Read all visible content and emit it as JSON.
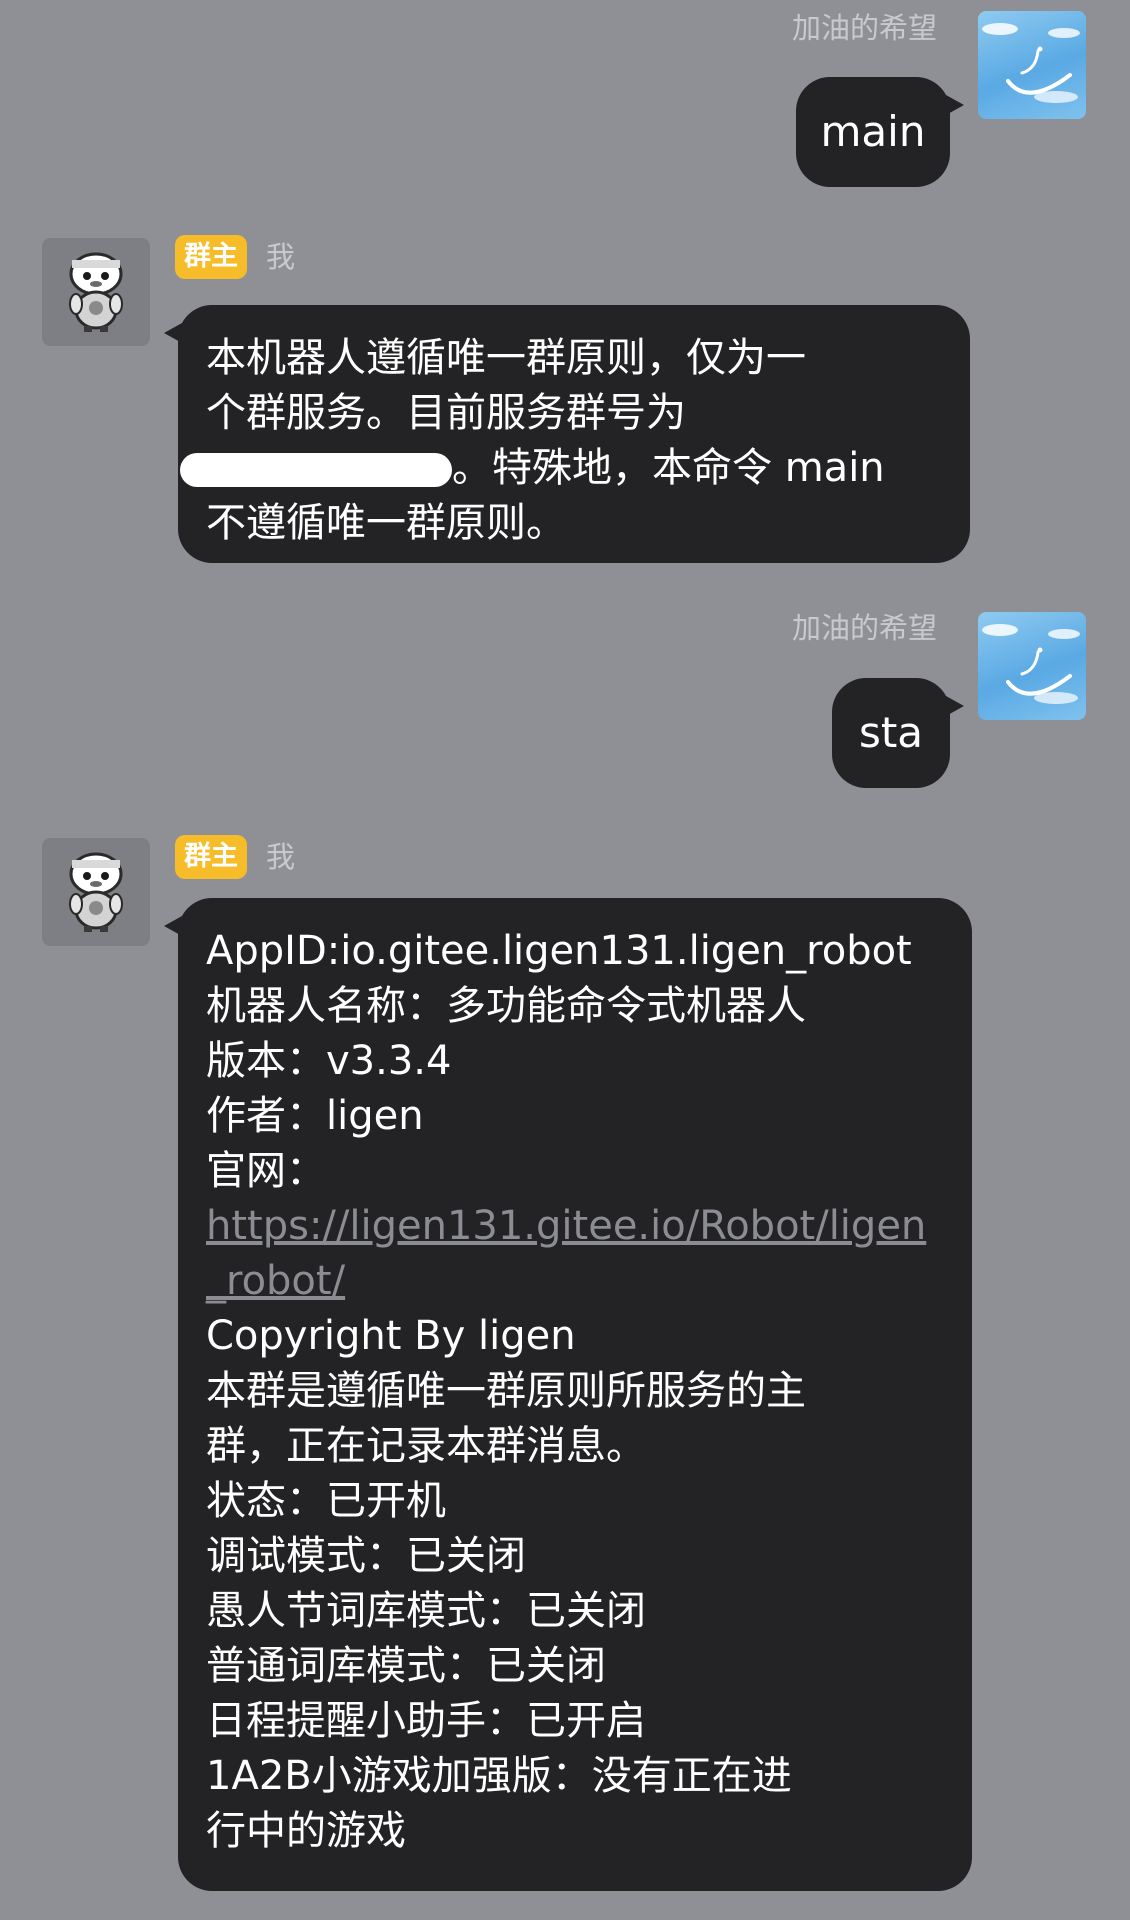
{
  "messages": [
    {
      "sender": "加油的希望",
      "text": "main"
    },
    {
      "badge": "群主",
      "sender": "我",
      "lines": [
        "本机器人遵循唯一群原则，仅为一",
        "个群服务。目前服务群号为",
        "。特殊地，本命令 main",
        "不遵循唯一群原则。"
      ]
    },
    {
      "sender": "加油的希望",
      "text": "sta"
    },
    {
      "badge": "群主",
      "sender": "我",
      "lines": [
        "AppID:io.gitee.ligen131.ligen_robot",
        "机器人名称：多功能命令式机器人",
        "版本：v3.3.4",
        "作者：ligen",
        "官网：",
        "https://ligen131.gitee.io/Robot/ligen",
        "_robot/",
        "Copyright By ligen",
        "本群是遵循唯一群原则所服务的主",
        "群，正在记录本群消息。",
        "状态：已开机",
        "调试模式：已关闭",
        "愚人节词库模式：已关闭",
        "普通词库模式：已关闭",
        "日程提醒小助手：已开启",
        "1A2B小游戏加强版：没有正在进",
        "行中的游戏"
      ]
    }
  ],
  "avatars": {
    "sender": "sky-swirl-avatar",
    "bot": "penguin-avatar"
  },
  "colors": {
    "background": "#8f9096",
    "bubble": "#232325",
    "badge": "#f7bc29",
    "link": "#8c8d92"
  }
}
